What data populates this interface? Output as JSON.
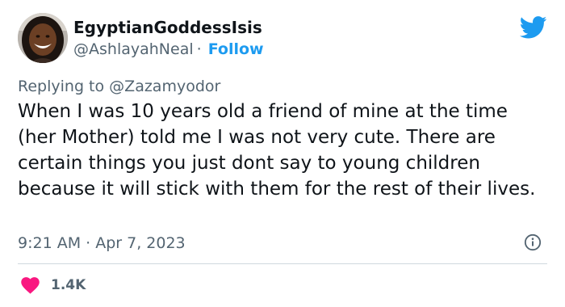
{
  "user": {
    "display_name": "EgyptianGoddessIsis",
    "handle": "@AshlayahNeal",
    "separator": "·",
    "follow_label": "Follow",
    "avatar_icon": "user-avatar-photo"
  },
  "reply": {
    "prefix": "Replying to",
    "mention": "@Zazamyodor"
  },
  "tweet": {
    "text": "When I was 10 years old a friend of mine at the time (her Mother) told me I was not very cute. There are certain things you just dont say to young children because it will stick with them for the rest of their lives.",
    "timestamp": "9:21 AM · Apr 7, 2023"
  },
  "stats": {
    "like_count": "1.4K"
  },
  "icons": {
    "brand": "twitter-bird-icon",
    "info": "info-icon",
    "like": "heart-icon"
  },
  "colors": {
    "accent": "#1d9bf0",
    "heart": "#f91880",
    "text": "#0f1419",
    "muted": "#536471",
    "divider": "#cfd9de"
  }
}
